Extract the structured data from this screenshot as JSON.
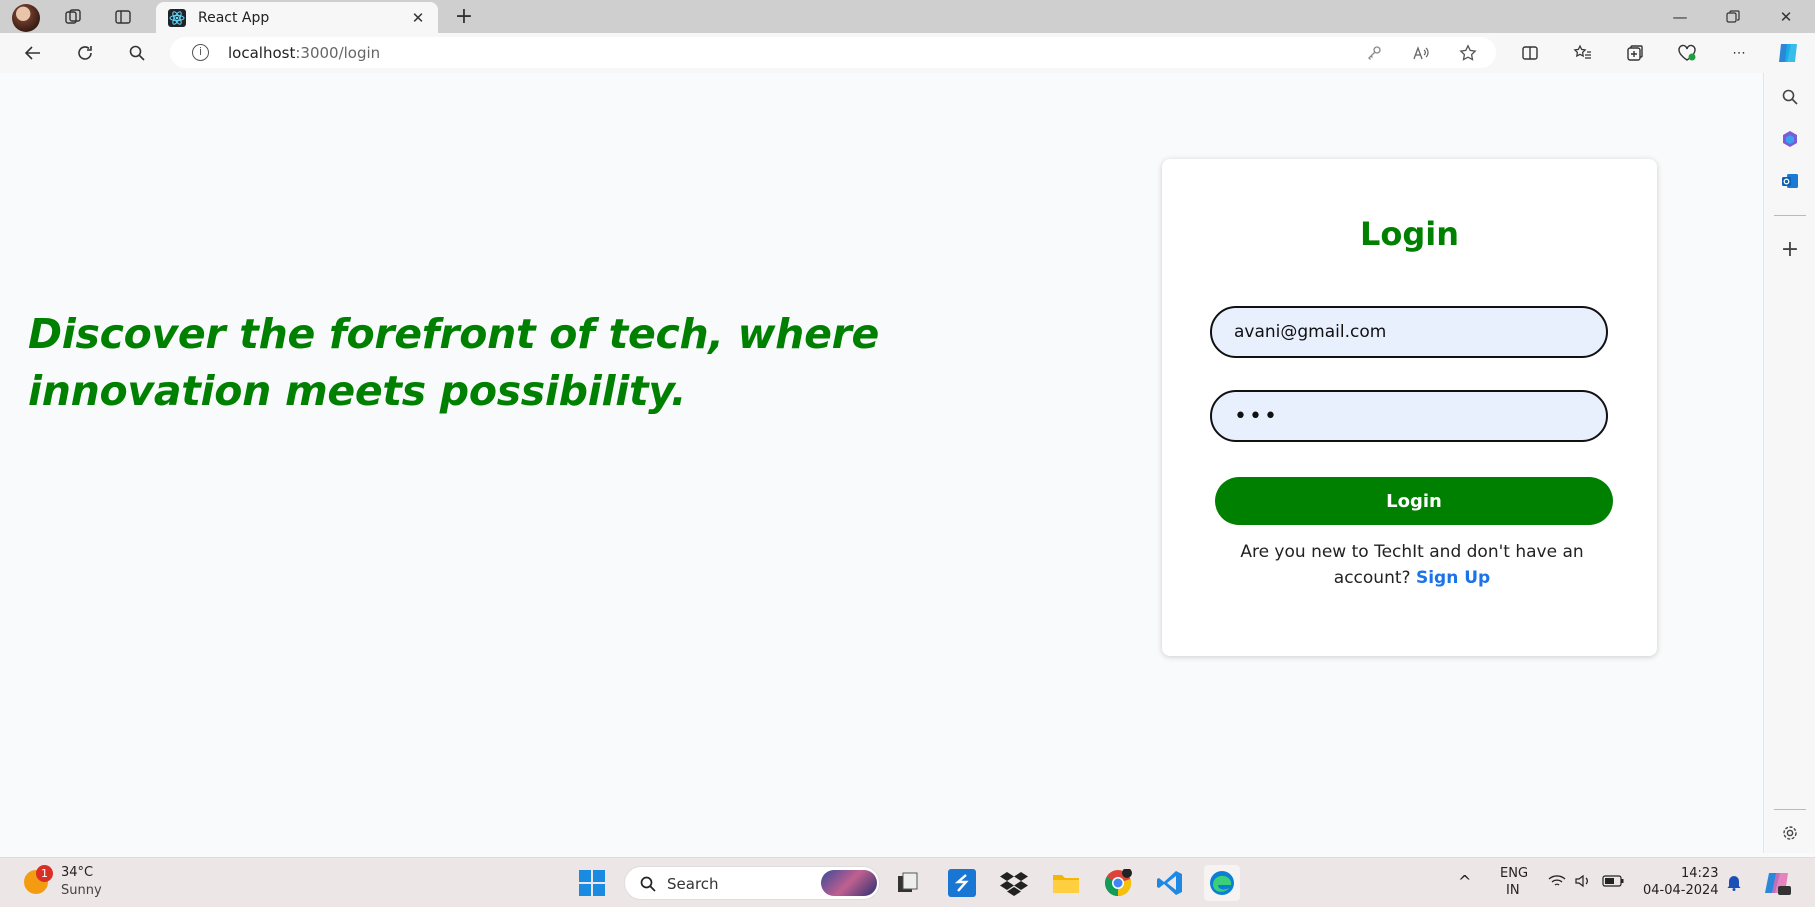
{
  "browser": {
    "tab_title": "React App",
    "url_host": "localhost",
    "url_path": ":3000/login"
  },
  "page": {
    "tagline": "Discover the forefront of tech, where innovation meets possibility.",
    "login": {
      "title": "Login",
      "email_value": "avani@gmail.com",
      "password_value": "•••",
      "button_label": "Login",
      "signup_prompt": "Are you new to TechIt and don't have an account?",
      "signup_link": "Sign Up"
    }
  },
  "taskbar": {
    "weather_badge": "1",
    "weather_temp": "34°C",
    "weather_cond": "Sunny",
    "search_label": "Search",
    "lang_line1": "ENG",
    "lang_line2": "IN",
    "time": "14:23",
    "date": "04-04-2024"
  },
  "colors": {
    "accent_green": "#008000",
    "link_blue": "#1a73e8",
    "input_bg": "#e8f0fe"
  }
}
